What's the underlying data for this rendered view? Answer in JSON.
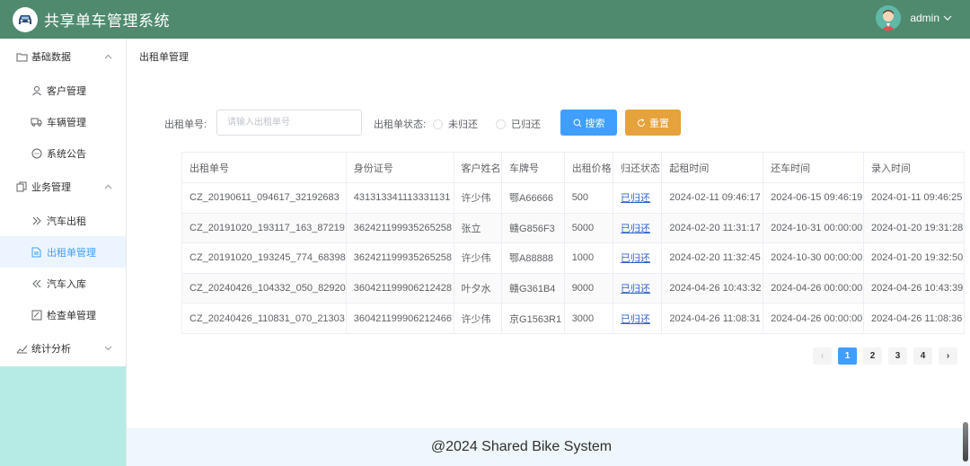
{
  "header": {
    "app_title": "共享单车管理系统",
    "username": "admin"
  },
  "sidebar": {
    "groups": [
      {
        "label": "基础数据",
        "icon": "folder-icon",
        "expanded": true
      },
      {
        "label": "业务管理",
        "icon": "document-copy-icon",
        "expanded": true
      },
      {
        "label": "统计分析",
        "icon": "trend-chart-icon",
        "expanded": false
      }
    ],
    "items": [
      {
        "label": "客户管理",
        "icon": "user-icon"
      },
      {
        "label": "车辆管理",
        "icon": "truck-icon"
      },
      {
        "label": "系统公告",
        "icon": "chat-icon"
      },
      {
        "label": "汽车出租",
        "icon": "double-right-icon"
      },
      {
        "label": "出租单管理",
        "icon": "document-icon",
        "active": true
      },
      {
        "label": "汽车入库",
        "icon": "double-left-icon"
      },
      {
        "label": "检查单管理",
        "icon": "edit-icon"
      }
    ]
  },
  "breadcrumb": "出租单管理",
  "search": {
    "order_label": "出租单号:",
    "order_placeholder": "请输入出租单号",
    "status_label": "出租单状态:",
    "radio_unreturned": "未归还",
    "radio_returned": "已归还",
    "search_button": "搜索",
    "reset_button": "重置"
  },
  "table": {
    "columns": [
      "出租单号",
      "身份证号",
      "客户姓名",
      "车牌号",
      "出租价格",
      "归还状态",
      "起租时间",
      "还车时间",
      "录入时间"
    ],
    "rows": [
      [
        "CZ_20190611_094617_32192683",
        "431313341113331131",
        "许少伟",
        "鄂A66666",
        "500",
        "已归还",
        "2024-02-11 09:46:17",
        "2024-06-15 09:46:19",
        "2024-01-11 09:46:25"
      ],
      [
        "CZ_20191020_193117_163_87219",
        "362421199935265258",
        "张立",
        "赣G856F3",
        "5000",
        "已归还",
        "2024-02-20 11:31:17",
        "2024-10-31 00:00:00",
        "2024-01-20 19:31:28"
      ],
      [
        "CZ_20191020_193245_774_68398",
        "362421199935265258",
        "许少伟",
        "鄂A88888",
        "1000",
        "已归还",
        "2024-02-20 11:32:45",
        "2024-10-30 00:00:00",
        "2024-01-20 19:32:50"
      ],
      [
        "CZ_20240426_104332_050_82920",
        "360421199906212428",
        "叶夕水",
        "赣G361B4",
        "9000",
        "已归还",
        "2024-04-26 10:43:32",
        "2024-04-26 00:00:00",
        "2024-04-26 10:43:39"
      ],
      [
        "CZ_20240426_110831_070_21303",
        "360421199906212466",
        "许少伟",
        "京G1563R1",
        "3000",
        "已归还",
        "2024-04-26 11:08:31",
        "2024-04-26 00:00:00",
        "2024-04-26 11:08:36"
      ]
    ]
  },
  "pagination": {
    "prev": "‹",
    "next": "›",
    "pages": [
      "1",
      "2",
      "3",
      "4"
    ],
    "current": "1"
  },
  "footer": "@2024 Shared Bike System",
  "colors": {
    "header": "#4f8a6f",
    "primary": "#409eff",
    "warning": "#e6a23c",
    "sidebar_fill": "#b6ebe5",
    "footer": "#eef7fb"
  }
}
